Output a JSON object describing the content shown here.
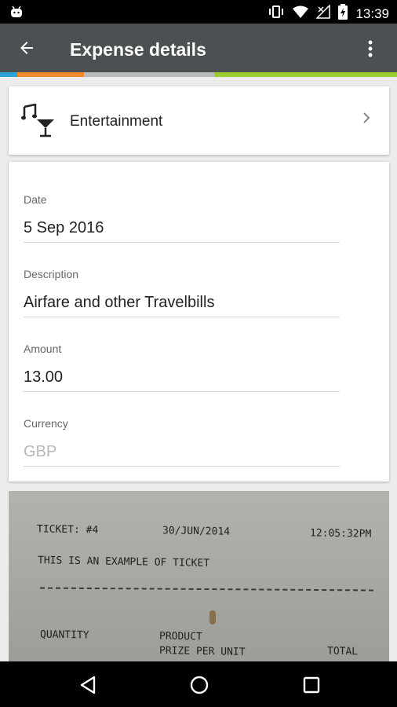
{
  "status_bar": {
    "time": "13:39"
  },
  "app_bar": {
    "title": "Expense details"
  },
  "category": {
    "label": "Entertainment"
  },
  "form": {
    "date": {
      "label": "Date",
      "value": "5 Sep 2016"
    },
    "description": {
      "label": "Description",
      "value": "Airfare and other Travelbills"
    },
    "amount": {
      "label": "Amount",
      "value": "13.00"
    },
    "currency": {
      "label": "Currency",
      "placeholder": "GBP"
    }
  },
  "receipt": {
    "ticket": "TICKET: #4",
    "date": "30/JUN/2014",
    "time": "12:05:32PM",
    "line": "THIS IS AN EXAMPLE OF TICKET",
    "col_quantity": "QUANTITY",
    "col_product": "PRODUCT",
    "col_prize": "PRIZE PER UNIT",
    "col_total": "TOTAL"
  },
  "colors": {
    "app_bar": "#4b5052",
    "stripe": [
      "#2aa3d6",
      "#f08a2a",
      "#b9bcbc",
      "#9ccc2e"
    ]
  }
}
